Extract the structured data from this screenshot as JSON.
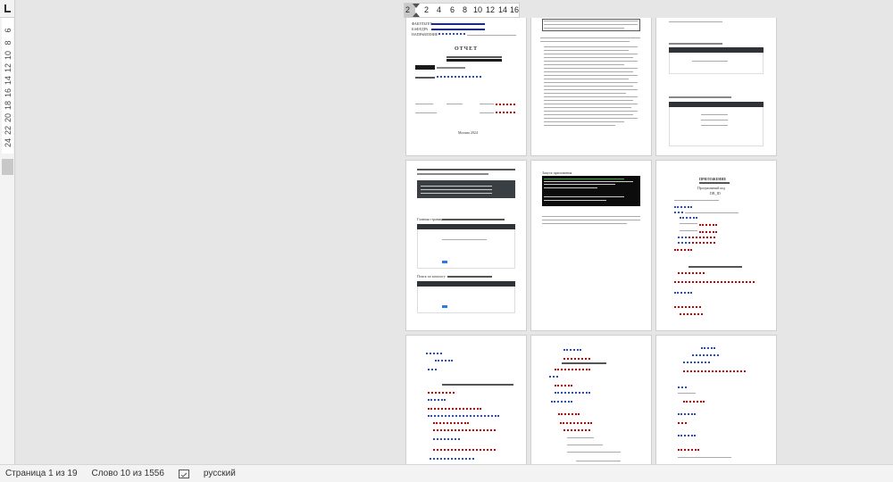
{
  "rulers": {
    "horizontal_ticks": [
      "2",
      "2",
      "4",
      "6",
      "8",
      "10",
      "12",
      "14",
      "16"
    ],
    "vertical_ticks": [
      "6",
      "8",
      "10",
      "12",
      "14",
      "16",
      "18",
      "20",
      "22",
      "24"
    ]
  },
  "pages": {
    "p1": {
      "header_lines": [
        "ФАКУЛЬТЕТ",
        "КАФЕДРА",
        "НАПРАВЛЕНИЕ"
      ],
      "title": "ОТЧЕТ",
      "date_label": "Москва 2024"
    },
    "p4": {
      "caption_main": "Главная страница",
      "caption_search": "Поиск по каталогу"
    },
    "p5": {
      "caption_terminal": "Запуск приложения"
    },
    "p6": {
      "appendix_title": "ПРИЛОЖЕНИЕ",
      "appendix_subtitle": "Программный код",
      "file_label": "DB_ID"
    }
  },
  "status_bar": {
    "page_info": "Страница 1 из 19",
    "word_count": "Слово 10 из 1556",
    "language": "русский",
    "proofing_icon": "proofing-check-icon"
  }
}
